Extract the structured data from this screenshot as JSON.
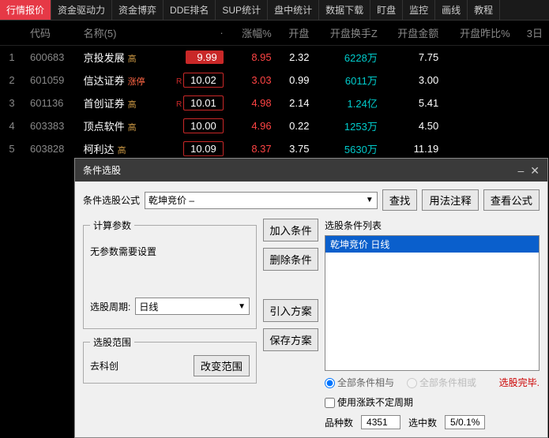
{
  "tabs": [
    "行情报价",
    "资金驱动力",
    "资金博弈",
    "DDE排名",
    "SUP统计",
    "盘中统计",
    "数据下载",
    "盯盘",
    "监控",
    "画线",
    "教程"
  ],
  "activeTab": 0,
  "headers": [
    "",
    "代码",
    "名称(5)",
    "·",
    "涨幅%",
    "开盘",
    "开盘换手Z",
    "开盘金额",
    "开盘昨比%",
    "3日"
  ],
  "rows": [
    {
      "idx": "1",
      "code": "600683",
      "name": "京投发展",
      "tag": "高",
      "tagClass": "gao",
      "rflag": "",
      "chg": "9.99",
      "chgOutline": false,
      "open": "8.95",
      "turn": "2.32",
      "amount": "6228万",
      "ratio": "7.75"
    },
    {
      "idx": "2",
      "code": "601059",
      "name": "信达证券",
      "tag": "涨停",
      "tagClass": "zt",
      "rflag": "R",
      "chg": "10.02",
      "chgOutline": true,
      "open": "3.03",
      "turn": "0.99",
      "amount": "6011万",
      "ratio": "3.00"
    },
    {
      "idx": "3",
      "code": "601136",
      "name": "首创证券",
      "tag": "高",
      "tagClass": "gao",
      "rflag": "R",
      "chg": "10.01",
      "chgOutline": true,
      "open": "4.98",
      "turn": "2.14",
      "amount": "1.24亿",
      "ratio": "5.41"
    },
    {
      "idx": "4",
      "code": "603383",
      "name": "顶点软件",
      "tag": "高",
      "tagClass": "gao",
      "rflag": "",
      "chg": "10.00",
      "chgOutline": true,
      "open": "4.96",
      "turn": "0.22",
      "amount": "1253万",
      "ratio": "4.50"
    },
    {
      "idx": "5",
      "code": "603828",
      "name": "柯利达",
      "tag": "高",
      "tagClass": "gao",
      "rflag": "",
      "chg": "10.09",
      "chgOutline": true,
      "open": "8.37",
      "turn": "3.75",
      "amount": "5630万",
      "ratio": "11.19"
    }
  ],
  "dialog": {
    "title": "条件选股",
    "formulaLabel": "条件选股公式",
    "formulaValue": "乾坤竞价   –",
    "findBtn": "查找",
    "usageBtn": "用法注释",
    "viewBtn": "查看公式",
    "calcLegend": "计算参数",
    "noParams": "无参数需要设置",
    "periodLabel": "选股周期:",
    "periodValue": "日线",
    "rangeLegend": "选股范围",
    "rangeText": "去科创",
    "changeRangeBtn": "改变范围",
    "addBtn": "加入条件",
    "delBtn": "删除条件",
    "importBtn": "引入方案",
    "saveBtn": "保存方案",
    "listLabel": "选股条件列表",
    "listItem": "乾坤竞价   日线",
    "radioAnd": "全部条件相与",
    "radioOr": "全部条件相或",
    "selDone": "选股完毕.",
    "useUncertain": "使用涨跌不定周期",
    "stockCountLabel": "品种数",
    "stockCount": "4351",
    "selectedLabel": "选中数",
    "selectedCount": "5/0.1%"
  }
}
